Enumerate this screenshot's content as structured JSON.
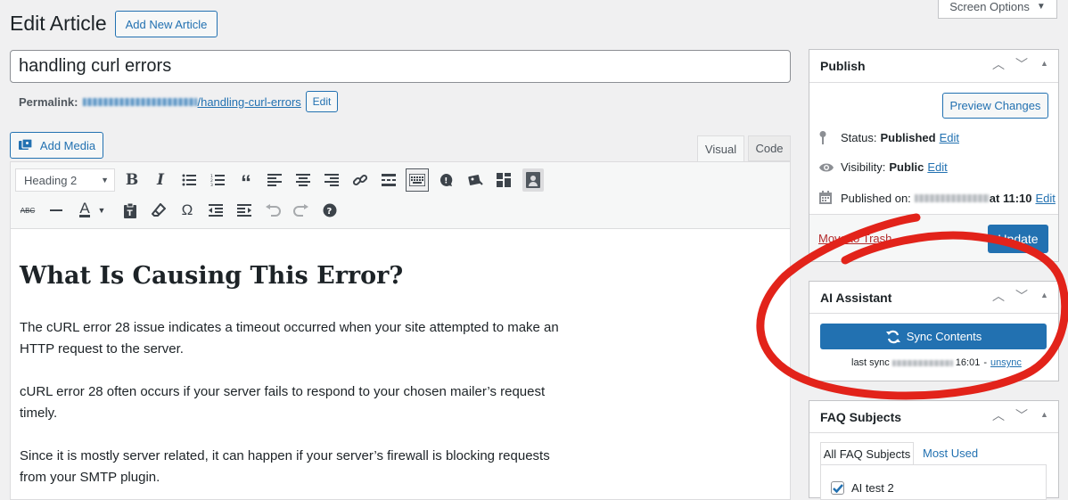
{
  "header": {
    "title": "Edit Article",
    "add_new_label": "Add New Article",
    "screen_options_label": "Screen Options"
  },
  "editor": {
    "post_title": "handling curl errors",
    "permalink_label": "Permalink:",
    "permalink_slug": "/handling-curl-errors",
    "permalink_edit_label": "Edit",
    "add_media_label": "Add Media",
    "tabs": [
      "Visual",
      "Code"
    ],
    "format_select": "Heading 2",
    "content": {
      "heading": "What Is Causing This Error?",
      "paragraphs": [
        "The cURL error 28 issue indicates a timeout occurred when your site attempted to make an HTTP request to the server.",
        "cURL error 28 often occurs if your server fails to respond to your chosen mailer’s request timely.",
        "Since it is mostly server related, it can happen if your server’s firewall is blocking requests from your SMTP plugin."
      ]
    }
  },
  "publish": {
    "title": "Publish",
    "preview_label": "Preview Changes",
    "status_label": "Status:",
    "status_value": "Published",
    "visibility_label": "Visibility:",
    "visibility_value": "Public",
    "published_on_label": "Published on:",
    "published_time": "at 11:10",
    "edit_label": "Edit",
    "trash_label": "Move to Trash",
    "update_label": "Update"
  },
  "ai_assistant": {
    "title": "AI Assistant",
    "sync_label": "Sync Contents",
    "last_sync_label": "last sync",
    "last_sync_time": "16:01",
    "separator": "-",
    "unsync_label": "unsync"
  },
  "faq_subjects": {
    "title": "FAQ Subjects",
    "tabs": [
      "All FAQ Subjects",
      "Most Used"
    ],
    "items": [
      {
        "label": "AI test 2",
        "checked": true
      }
    ]
  },
  "colors": {
    "accent": "#2271b1",
    "annotation": "#e2231a",
    "trash": "#b32d2e"
  }
}
